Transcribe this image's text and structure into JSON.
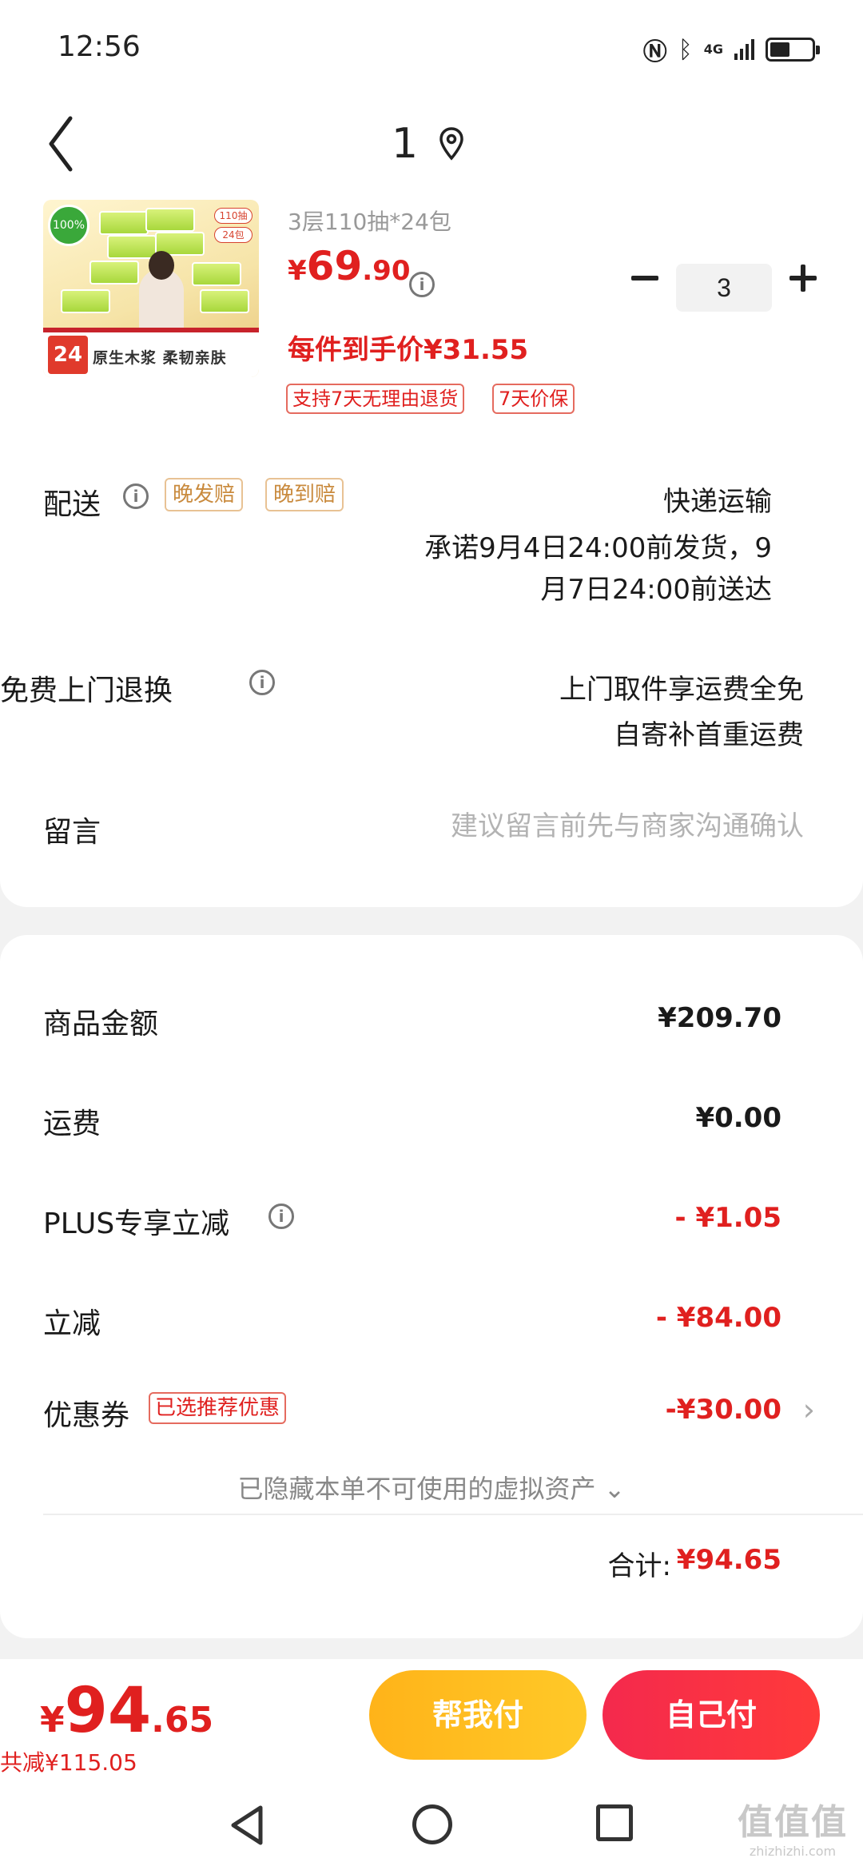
{
  "status_bar": {
    "time": "12:56",
    "network": "4G"
  },
  "header": {
    "title": "1"
  },
  "product": {
    "spec": "3层110抽*24包",
    "price_currency": "¥",
    "price_int": "69",
    "price_dec": ".90",
    "unit_price": "每件到手价¥31.55",
    "tags": [
      "支持7天无理由退货",
      "7天价保"
    ],
    "quantity": "3",
    "image_text": {
      "badge": "100%",
      "tag_top": "110抽",
      "tag_mid": "24包",
      "count": "24",
      "caption": "原生木浆 柔韧亲肤"
    }
  },
  "delivery": {
    "label": "配送",
    "tags": [
      "晚发赔",
      "晚到赔"
    ],
    "method": "快递运输",
    "promise_line1": "承诺9月4日24:00前发货，9",
    "promise_line2": "月7日24:00前送达"
  },
  "exchange": {
    "label": "免费上门退换",
    "line1": "上门取件享运费全免",
    "line2": "自寄补首重运费"
  },
  "message": {
    "label": "留言",
    "placeholder": "建议留言前先与商家沟通确认"
  },
  "summary": {
    "goods_label": "商品金额",
    "goods_value": "¥209.70",
    "freight_label": "运费",
    "freight_value": "¥0.00",
    "plus_label": "PLUS专享立减",
    "plus_value": "- ¥1.05",
    "cut_label": "立减",
    "cut_value": "- ¥84.00",
    "coupon_label": "优惠券",
    "coupon_tag": "已选推荐优惠",
    "coupon_value": "-¥30.00",
    "hidden_assets": "已隐藏本单不可使用的虚拟资产 ⌄",
    "total_label": "合计:",
    "total_value": "¥94.65"
  },
  "pay_bar": {
    "currency": "¥",
    "price_int": "94",
    "price_dec": ".65",
    "saved": "共减¥115.05",
    "help_pay": "帮我付",
    "self_pay": "自己付"
  },
  "watermark": {
    "big": "值值值",
    "small": "zhizhizhi.com"
  },
  "colors": {
    "accent_red": "#e0201f",
    "help_pay_yellow": "#ffb319",
    "self_pay_red": "#f4294d",
    "tag_orange": "#c98a3d"
  }
}
